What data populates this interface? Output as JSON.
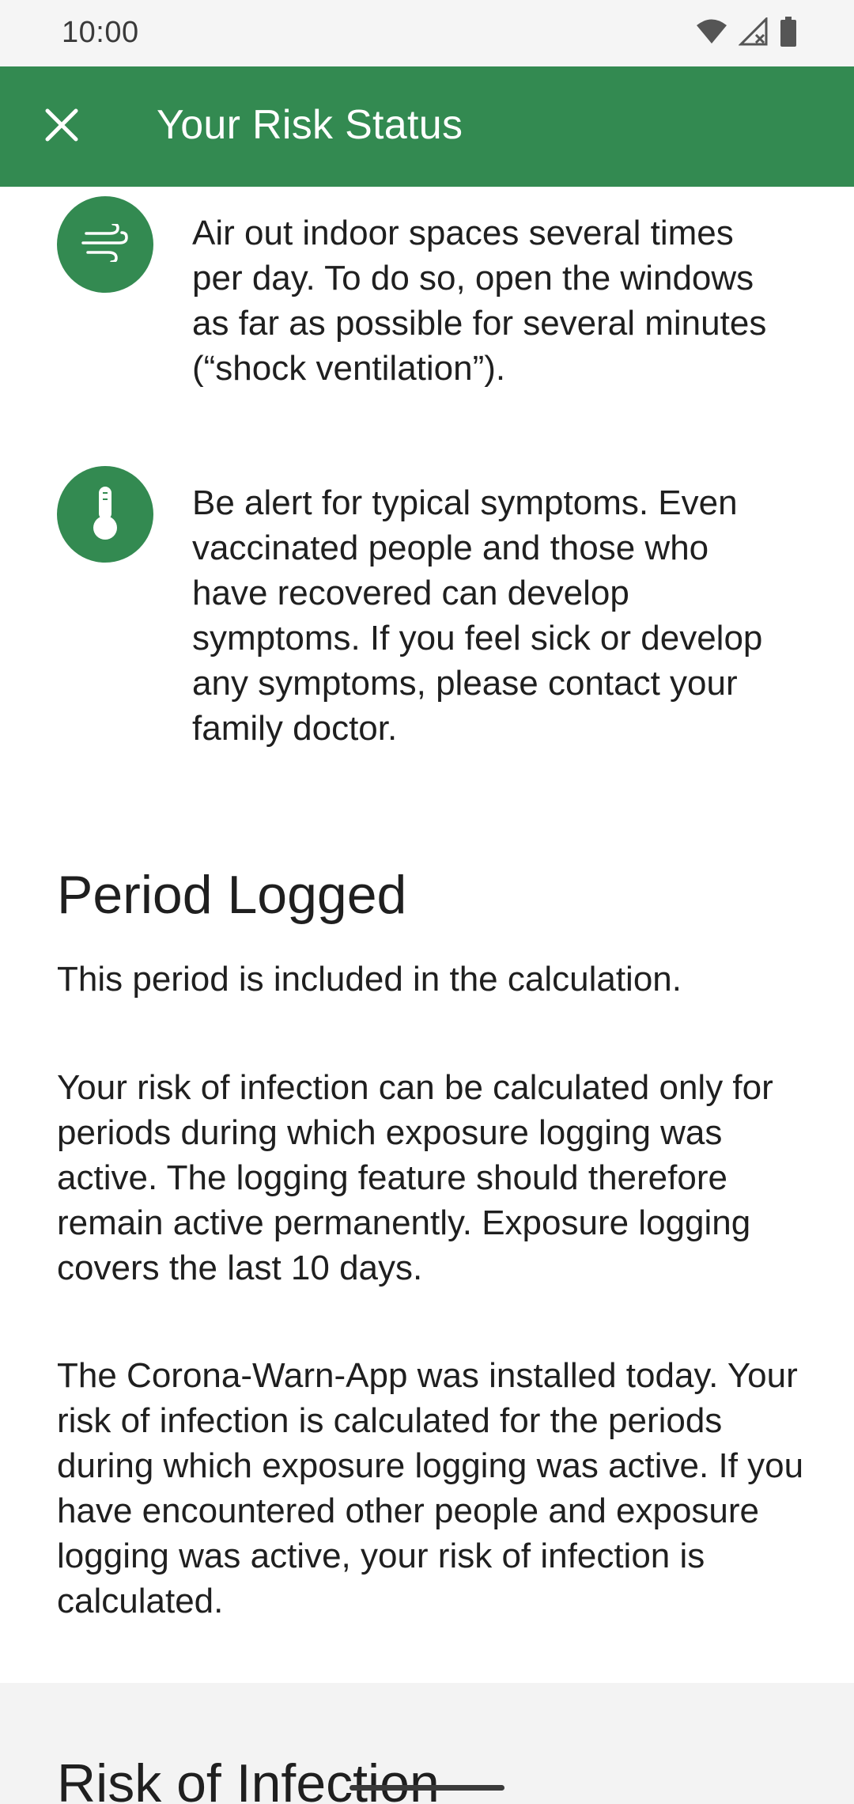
{
  "status_bar": {
    "time": "10:00",
    "icons": [
      "wifi-icon",
      "signal-icon",
      "battery-icon"
    ]
  },
  "app_bar": {
    "close_icon": "close-icon",
    "title": "Your Risk Status",
    "color": "#338a51"
  },
  "tips": [
    {
      "icon": "wind-icon",
      "text": "Air out indoor spaces several times per day. To do so, open the windows as far as possible for several minutes (“shock ventilation”)."
    },
    {
      "icon": "thermometer-icon",
      "text": "Be alert for typical symptoms. Even vaccinated people and those who have recovered can develop symptoms. If you feel sick or develop any symptoms, please contact your family doctor."
    }
  ],
  "period_logged": {
    "heading": "Period Logged",
    "para1": "This period is included in the calculation.",
    "para2": "Your risk of infection can be calculated only for periods during which exposure logging was active. The logging feature should therefore remain active permanently. Exposure logging covers the last 10 days.",
    "para3": "The Corona-Warn-App was installed today. Your risk of infection is calculated for the periods during which exposure logging was active. If you have encountered other people and exposure logging was active, your risk of infection is calculated."
  },
  "next_section": {
    "heading": "Risk of Infection"
  }
}
